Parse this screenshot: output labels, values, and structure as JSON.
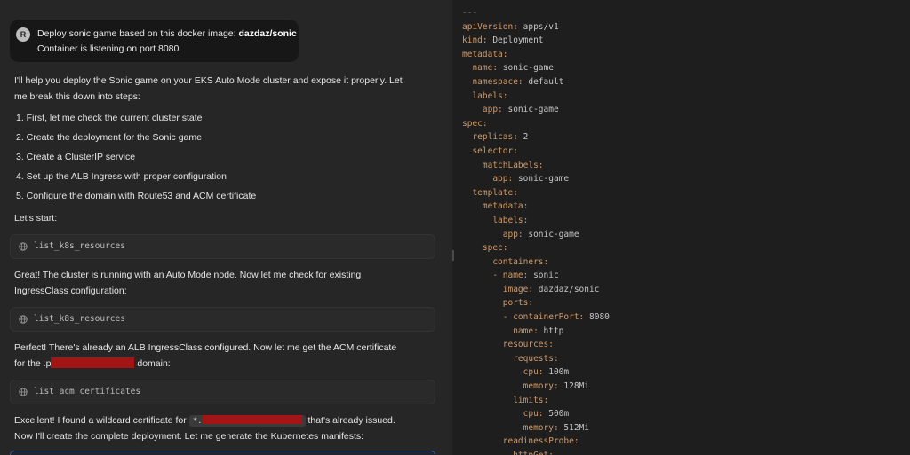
{
  "user_message": {
    "avatar_initial": "R",
    "line1_prefix": "Deploy sonic game based on this docker image: ",
    "line1_image": "dazdaz/sonic",
    "line2": "Container is listening on port 8080"
  },
  "assistant": {
    "intro_line1": "I'll help you deploy the Sonic game on your EKS Auto Mode cluster and expose it properly. Let",
    "intro_line2": "me break this down into steps:",
    "steps": [
      "1. First, let me check the current cluster state",
      "2. Create the deployment for the Sonic game",
      "3. Create a ClusterIP service",
      "4. Set up the ALB Ingress with proper configuration",
      "5. Configure the domain with Route53 and ACM certificate"
    ],
    "lets_start": "Let's start:",
    "tool1": "list_k8s_resources",
    "msg2_line1": "Great! The cluster is running with an Auto Mode node. Now let me check for existing",
    "msg2_line2": "IngressClass configuration:",
    "tool2": "list_k8s_resources",
    "msg3_line1": "Perfect! There's already an ALB IngressClass configured. Now let me get the ACM certificate",
    "msg3_line2_prefix": "for the .",
    "msg3_line2_partial": "p",
    "msg3_line2_suffix": " domain:",
    "tool3": "list_acm_certificates",
    "msg4_line1_prefix": "Excellent! I found a wildcard certificate for ",
    "msg4_pill": "*.",
    "msg4_line1_suffix": " that's already issued.",
    "msg4_line2": "Now I'll create the complete deployment. Let me generate the Kubernetes manifests:"
  },
  "icons": {
    "tool_icon": "globe-icon"
  },
  "colors": {
    "redaction": "#a31515",
    "yaml_key": "#d19a66",
    "yaml_value": "#c6c6c6"
  },
  "yaml": [
    {
      "k": "---",
      "v": ""
    },
    {
      "k": "apiVersion:",
      "v": " apps/v1"
    },
    {
      "k": "kind:",
      "v": " Deployment"
    },
    {
      "k": "metadata:",
      "v": ""
    },
    {
      "k": "  name:",
      "v": " sonic-game"
    },
    {
      "k": "  namespace:",
      "v": " default"
    },
    {
      "k": "  labels:",
      "v": ""
    },
    {
      "k": "    app:",
      "v": " sonic-game"
    },
    {
      "k": "spec:",
      "v": ""
    },
    {
      "k": "  replicas:",
      "v": " 2"
    },
    {
      "k": "  selector:",
      "v": ""
    },
    {
      "k": "    matchLabels:",
      "v": ""
    },
    {
      "k": "      app:",
      "v": " sonic-game"
    },
    {
      "k": "  template:",
      "v": ""
    },
    {
      "k": "    metadata:",
      "v": ""
    },
    {
      "k": "      labels:",
      "v": ""
    },
    {
      "k": "        app:",
      "v": " sonic-game"
    },
    {
      "k": "    spec:",
      "v": ""
    },
    {
      "k": "      containers:",
      "v": ""
    },
    {
      "k": "      - name:",
      "v": " sonic"
    },
    {
      "k": "        image:",
      "v": " dazdaz/sonic"
    },
    {
      "k": "        ports:",
      "v": ""
    },
    {
      "k": "        - containerPort:",
      "v": " 8080"
    },
    {
      "k": "          name:",
      "v": " http"
    },
    {
      "k": "        resources:",
      "v": ""
    },
    {
      "k": "          requests:",
      "v": ""
    },
    {
      "k": "            cpu:",
      "v": " 100m"
    },
    {
      "k": "            memory:",
      "v": " 128Mi"
    },
    {
      "k": "          limits:",
      "v": ""
    },
    {
      "k": "            cpu:",
      "v": " 500m"
    },
    {
      "k": "            memory:",
      "v": " 512Mi"
    },
    {
      "k": "        readinessProbe:",
      "v": ""
    },
    {
      "k": "          httpGet:",
      "v": ""
    }
  ]
}
